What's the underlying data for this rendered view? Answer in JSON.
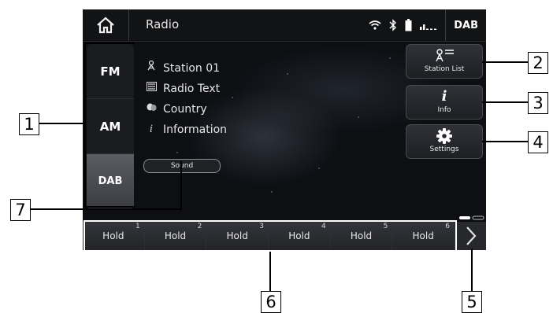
{
  "header": {
    "title": "Radio",
    "band_indicator": "DAB"
  },
  "bands": [
    {
      "label": "FM"
    },
    {
      "label": "AM"
    },
    {
      "label": "DAB",
      "active": true
    }
  ],
  "station_info": {
    "station": "Station 01",
    "radio_text": "Radio Text",
    "genre": "Country",
    "information": "Information"
  },
  "sound_button": {
    "label": "Sound"
  },
  "side_buttons": {
    "station_list": "Station List",
    "info": "Info",
    "settings": "Settings"
  },
  "presets": [
    {
      "num": "1",
      "label": "Hold"
    },
    {
      "num": "2",
      "label": "Hold"
    },
    {
      "num": "3",
      "label": "Hold"
    },
    {
      "num": "4",
      "label": "Hold"
    },
    {
      "num": "5",
      "label": "Hold"
    },
    {
      "num": "6",
      "label": "Hold"
    }
  ],
  "callouts": {
    "c1": "1",
    "c2": "2",
    "c3": "3",
    "c4": "4",
    "c5": "5",
    "c6": "6",
    "c7": "7"
  },
  "colors": {
    "screen_bg": "#0b0c0e",
    "button_border": "#47494e",
    "text": "#e8e8e8"
  }
}
